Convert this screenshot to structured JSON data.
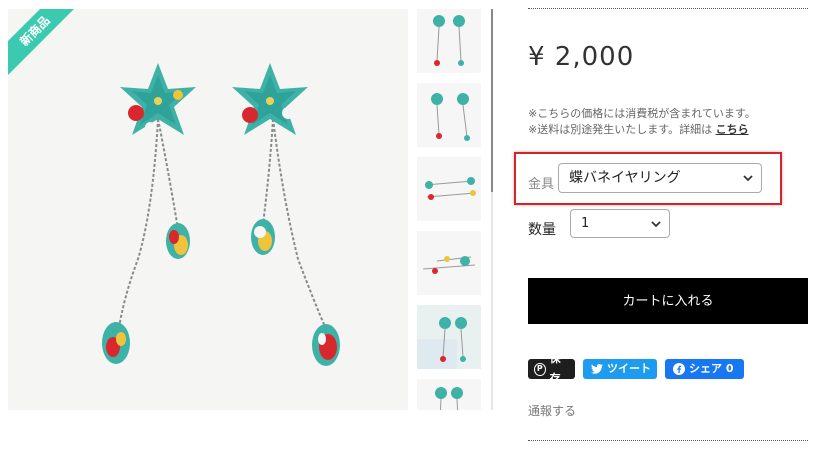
{
  "product": {
    "badge": "新商品",
    "price": "¥ 2,000",
    "notes": {
      "tax": "※こちらの価格には消費税が含まれています。",
      "shipping_prefix": "※送料は別途発生いたします。詳細は",
      "shipping_link": "こちら"
    }
  },
  "options": {
    "fitting_label": "金具",
    "fitting_value": "蝶バネイヤリング",
    "quantity_label": "数量",
    "quantity_value": "1"
  },
  "cart": {
    "button_label": "カートに入れる"
  },
  "share": {
    "pinterest_label": "保存",
    "twitter_label": "ツイート",
    "facebook_label": "シェア 0"
  },
  "report": {
    "label": "通報する"
  },
  "colors": {
    "accent_badge": "#3bc9b0",
    "highlight_border": "#d0262a",
    "cart_bg": "#000000",
    "twitter": "#1d9bf0",
    "facebook": "#1877f2",
    "pinterest": "#1e1e1e"
  },
  "icons": [
    "pinterest-icon",
    "twitter-icon",
    "facebook-icon",
    "chevron-down-icon"
  ]
}
